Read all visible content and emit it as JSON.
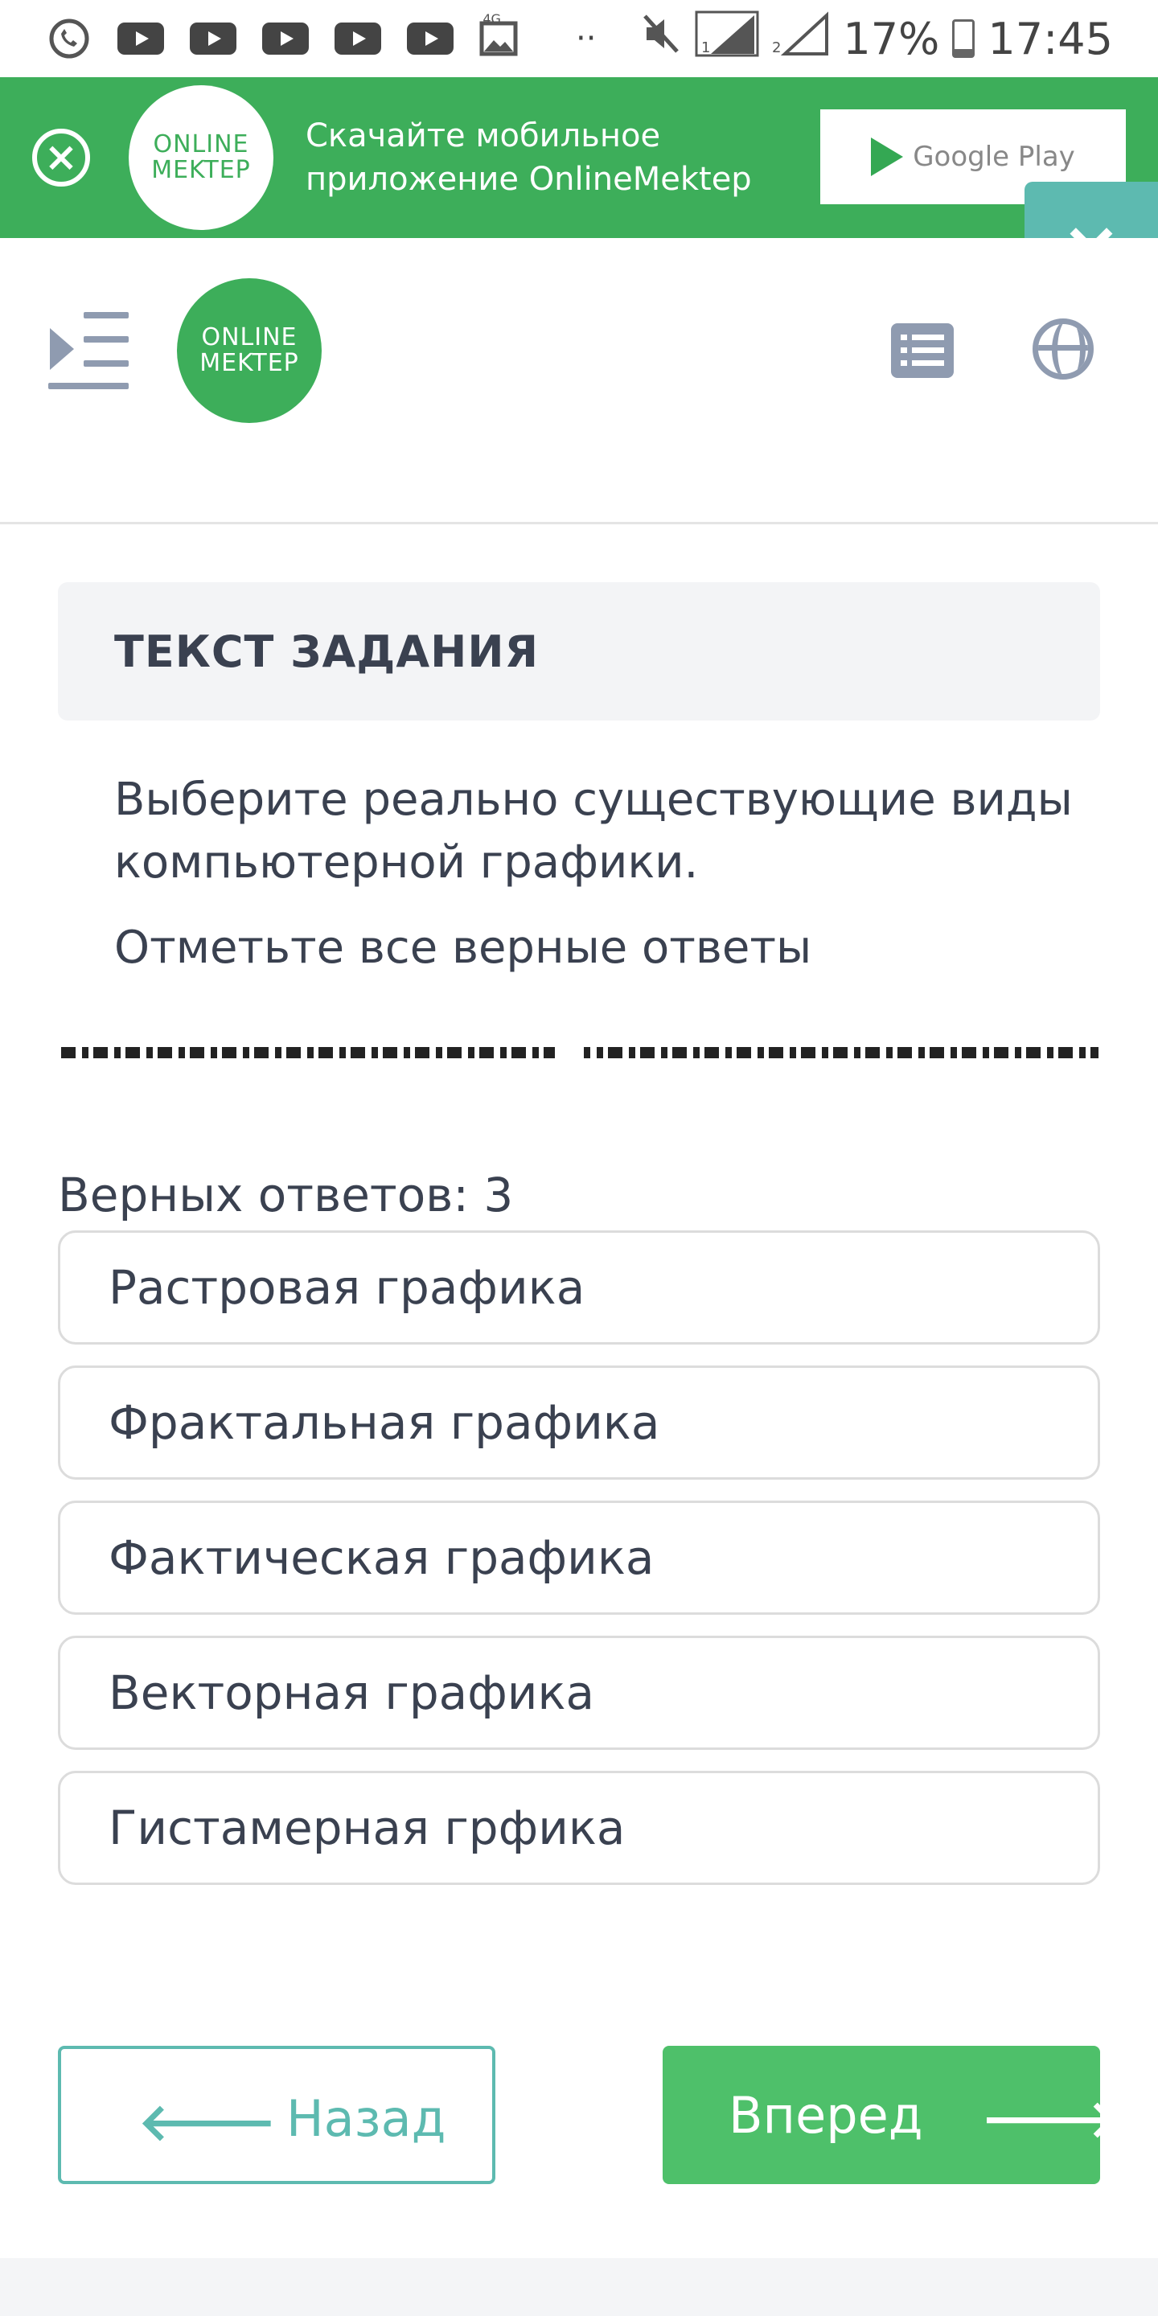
{
  "status_bar": {
    "battery": "17%",
    "time": "17:45",
    "network": "4G",
    "dots": "··"
  },
  "banner": {
    "logo_line1": "ONLINE",
    "logo_line2": "MEKTEP",
    "text_line1": "Скачайте мобильное",
    "text_line2": "приложение OnlineMektep",
    "store": "Google Play"
  },
  "header": {
    "logo_line1": "ONLINE",
    "logo_line2": "MEKTEP"
  },
  "task": {
    "heading": "ТЕКСТ ЗАДАНИЯ",
    "question": "Выберите реально существующие виды компьютерной графики.",
    "hint": "Отметьте все верные ответы",
    "correct_count": "Верных ответов: 3"
  },
  "options": [
    "Растровая графика",
    "Фрактальная графика",
    "Фактическая графика",
    "Векторная графика",
    "Гистамерная грфика"
  ],
  "nav": {
    "back": "Назад",
    "next": "Вперед"
  },
  "colors": {
    "brand_green": "#3dae5a",
    "teal": "#5dbab0",
    "next_green": "#4ec06a"
  }
}
